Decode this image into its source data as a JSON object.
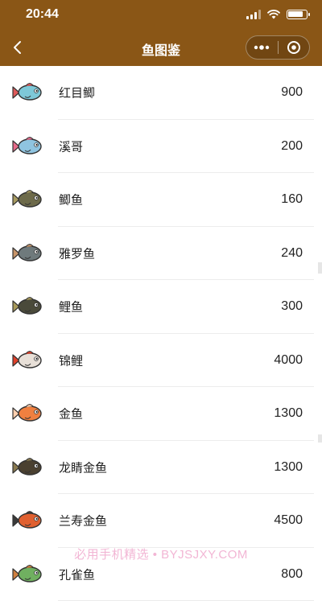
{
  "status_bar": {
    "time": "20:44",
    "signal_strength": 3,
    "battery_level": 0.85
  },
  "nav": {
    "back_icon": "chevron-left-icon",
    "title": "鱼图鉴",
    "menu_icon": "more-dots-icon",
    "close_icon": "target-circle-icon"
  },
  "fish_list": [
    {
      "name": "红目鲫",
      "price": "900",
      "icon": "fish-icon",
      "color": "#7ec8d8",
      "accent": "#e05a5a"
    },
    {
      "name": "溪哥",
      "price": "200",
      "icon": "fish-icon",
      "color": "#8fc4e0",
      "accent": "#e86a8a"
    },
    {
      "name": "鲫鱼",
      "price": "160",
      "icon": "fish-icon",
      "color": "#6d6a4a",
      "accent": "#a89b60"
    },
    {
      "name": "雅罗鱼",
      "price": "240",
      "icon": "fish-icon",
      "color": "#6f7a7c",
      "accent": "#c8956a"
    },
    {
      "name": "鲤鱼",
      "price": "300",
      "icon": "fish-icon",
      "color": "#4a4a3a",
      "accent": "#a89a5a"
    },
    {
      "name": "锦鲤",
      "price": "4000",
      "icon": "fish-icon",
      "color": "#e8e0d8",
      "accent": "#e0402a"
    },
    {
      "name": "金鱼",
      "price": "1300",
      "icon": "fish-icon",
      "color": "#f08040",
      "accent": "#ffd0b0"
    },
    {
      "name": "龙睛金鱼",
      "price": "1300",
      "icon": "fish-icon",
      "color": "#4a4030",
      "accent": "#8a7a50"
    },
    {
      "name": "兰寿金鱼",
      "price": "4500",
      "icon": "fish-icon",
      "color": "#e06030",
      "accent": "#3a3a3a"
    },
    {
      "name": "孔雀鱼",
      "price": "800",
      "icon": "fish-icon",
      "color": "#70b060",
      "accent": "#d08040"
    }
  ],
  "watermark": "必用手机精选 • BYJSJXY.COM",
  "colors": {
    "nav_background": "#8a5616",
    "divider": "#ececec",
    "text": "#222222"
  }
}
